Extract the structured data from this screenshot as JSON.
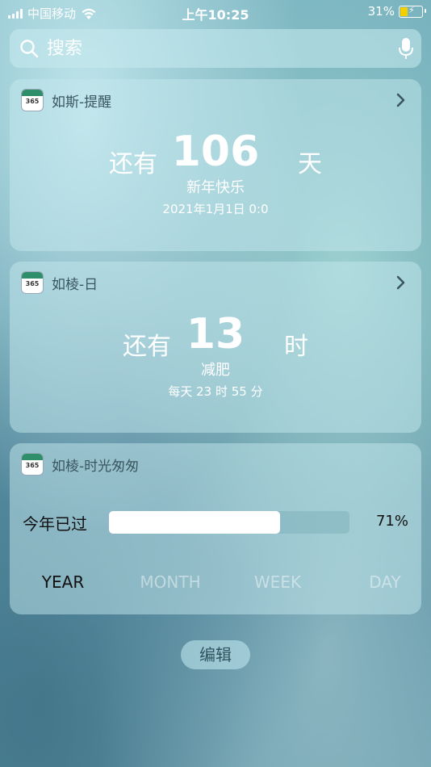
{
  "status_bar": {
    "carrier": "中国移动",
    "time": "上午10:25",
    "battery": "31%",
    "battery_fraction": 0.31
  },
  "search": {
    "placeholder": "搜索"
  },
  "widgets": [
    {
      "title": "如斯-提醒",
      "prefix": "还有",
      "number": "106",
      "suffix": "天",
      "event": "新年快乐",
      "date": "2021年1月1日 0:0"
    },
    {
      "title": "如棱-日",
      "prefix": "还有",
      "number": "13",
      "suffix": "时",
      "event": "减肥",
      "date": "每天 23 时 55 分"
    },
    {
      "title": "如棱-时光匆匆",
      "progress_label": "今年已过",
      "progress_value": "71%",
      "progress_fraction": 0.71,
      "tabs": [
        "YEAR",
        "MONTH",
        "WEEK",
        "DAY"
      ],
      "active_tab": "YEAR"
    }
  ],
  "app_icon_text": "365",
  "edit_button": "编辑"
}
